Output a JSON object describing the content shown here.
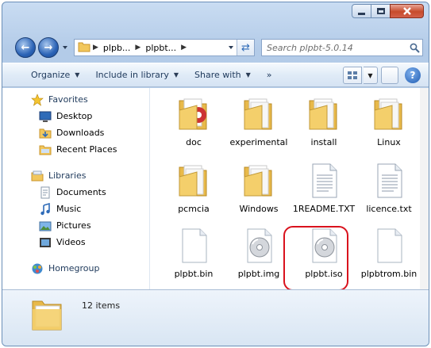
{
  "window": {
    "address": {
      "crumbs": [
        "plpb...",
        "plpbt..."
      ],
      "search_placeholder": "Search plpbt-5.0.14"
    },
    "toolbar": {
      "organize": "Organize",
      "include_in_library": "Include in library",
      "share_with": "Share with",
      "more": "»",
      "help": "?"
    },
    "nav": {
      "favorites": {
        "label": "Favorites",
        "items": [
          "Desktop",
          "Downloads",
          "Recent Places"
        ]
      },
      "libraries": {
        "label": "Libraries",
        "items": [
          "Documents",
          "Music",
          "Pictures",
          "Videos"
        ]
      },
      "homegroup": "Homegroup"
    },
    "files": [
      {
        "name": "doc",
        "type": "folder-doc"
      },
      {
        "name": "experimental",
        "type": "folder"
      },
      {
        "name": "install",
        "type": "folder"
      },
      {
        "name": "Linux",
        "type": "folder"
      },
      {
        "name": "pcmcia",
        "type": "folder"
      },
      {
        "name": "Windows",
        "type": "folder"
      },
      {
        "name": "1README.TXT",
        "type": "text"
      },
      {
        "name": "licence.txt",
        "type": "text"
      },
      {
        "name": "plpbt.bin",
        "type": "blank"
      },
      {
        "name": "plpbt.img",
        "type": "disc"
      },
      {
        "name": "plpbt.iso",
        "type": "disc",
        "highlighted": true
      },
      {
        "name": "plpbtrom.bin",
        "type": "blank"
      }
    ],
    "status": {
      "count": "12 items"
    },
    "colors": {
      "highlight": "#d9121d",
      "folder": "#f2c75c",
      "accent": "#1e395b"
    }
  }
}
